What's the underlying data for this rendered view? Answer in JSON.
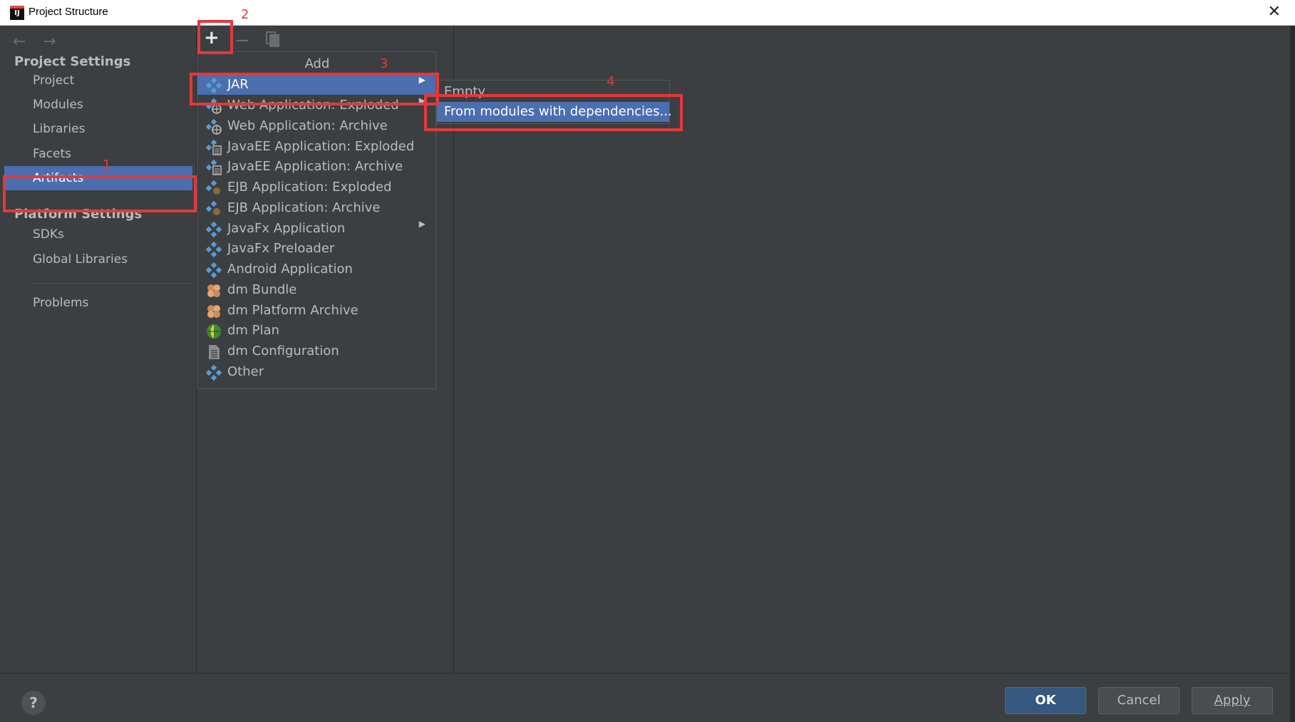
{
  "window": {
    "title": "Project Structure",
    "app_icon": "IJ",
    "close_glyph": "✕"
  },
  "sidebar": {
    "back_glyph": "←",
    "forward_glyph": "→",
    "project_settings_header": "Project Settings",
    "project_items": [
      "Project",
      "Modules",
      "Libraries",
      "Facets",
      "Artifacts"
    ],
    "selected_item": "Artifacts",
    "platform_settings_header": "Platform Settings",
    "platform_items": [
      "SDKs",
      "Global Libraries"
    ],
    "problems": "Problems"
  },
  "toolbar": {
    "add_glyph": "+",
    "remove_glyph": "−"
  },
  "add_menu": {
    "title": "Add",
    "items": [
      {
        "label": "JAR",
        "icon": "artifact-icon",
        "submenu": true
      },
      {
        "label": "Web Application: Exploded",
        "icon": "web-app-icon",
        "submenu": true
      },
      {
        "label": "Web Application: Archive",
        "icon": "web-app-icon",
        "submenu": false
      },
      {
        "label": "JavaEE Application: Exploded",
        "icon": "javaee-icon",
        "submenu": false
      },
      {
        "label": "JavaEE Application: Archive",
        "icon": "javaee-icon",
        "submenu": false
      },
      {
        "label": "EJB Application: Exploded",
        "icon": "ejb-icon",
        "submenu": false
      },
      {
        "label": "EJB Application: Archive",
        "icon": "ejb-icon",
        "submenu": false
      },
      {
        "label": "JavaFx Application",
        "icon": "artifact-icon",
        "submenu": true
      },
      {
        "label": "JavaFx Preloader",
        "icon": "artifact-icon",
        "submenu": false
      },
      {
        "label": "Android Application",
        "icon": "artifact-icon",
        "submenu": false
      },
      {
        "label": "dm Bundle",
        "icon": "bundle-icon",
        "submenu": false
      },
      {
        "label": "dm Platform Archive",
        "icon": "bundle-icon",
        "submenu": false
      },
      {
        "label": "dm Plan",
        "icon": "globe-icon",
        "submenu": false
      },
      {
        "label": "dm Configuration",
        "icon": "document-icon",
        "submenu": false
      },
      {
        "label": "Other",
        "icon": "artifact-icon",
        "submenu": false
      }
    ],
    "selected_index": 0,
    "arrow_glyph": "▶"
  },
  "submenu": {
    "items": [
      "Empty",
      "From modules with dependencies..."
    ],
    "selected_index": 1
  },
  "footer": {
    "help_glyph": "?",
    "ok_label": "OK",
    "cancel_label": "Cancel",
    "apply_label": "Apply"
  },
  "annotations": [
    "1",
    "2",
    "3",
    "4"
  ],
  "colors": {
    "selection": "#4b6eaf",
    "background": "#3c3f41",
    "annotation": "#e5383b",
    "ok_button": "#365880"
  }
}
